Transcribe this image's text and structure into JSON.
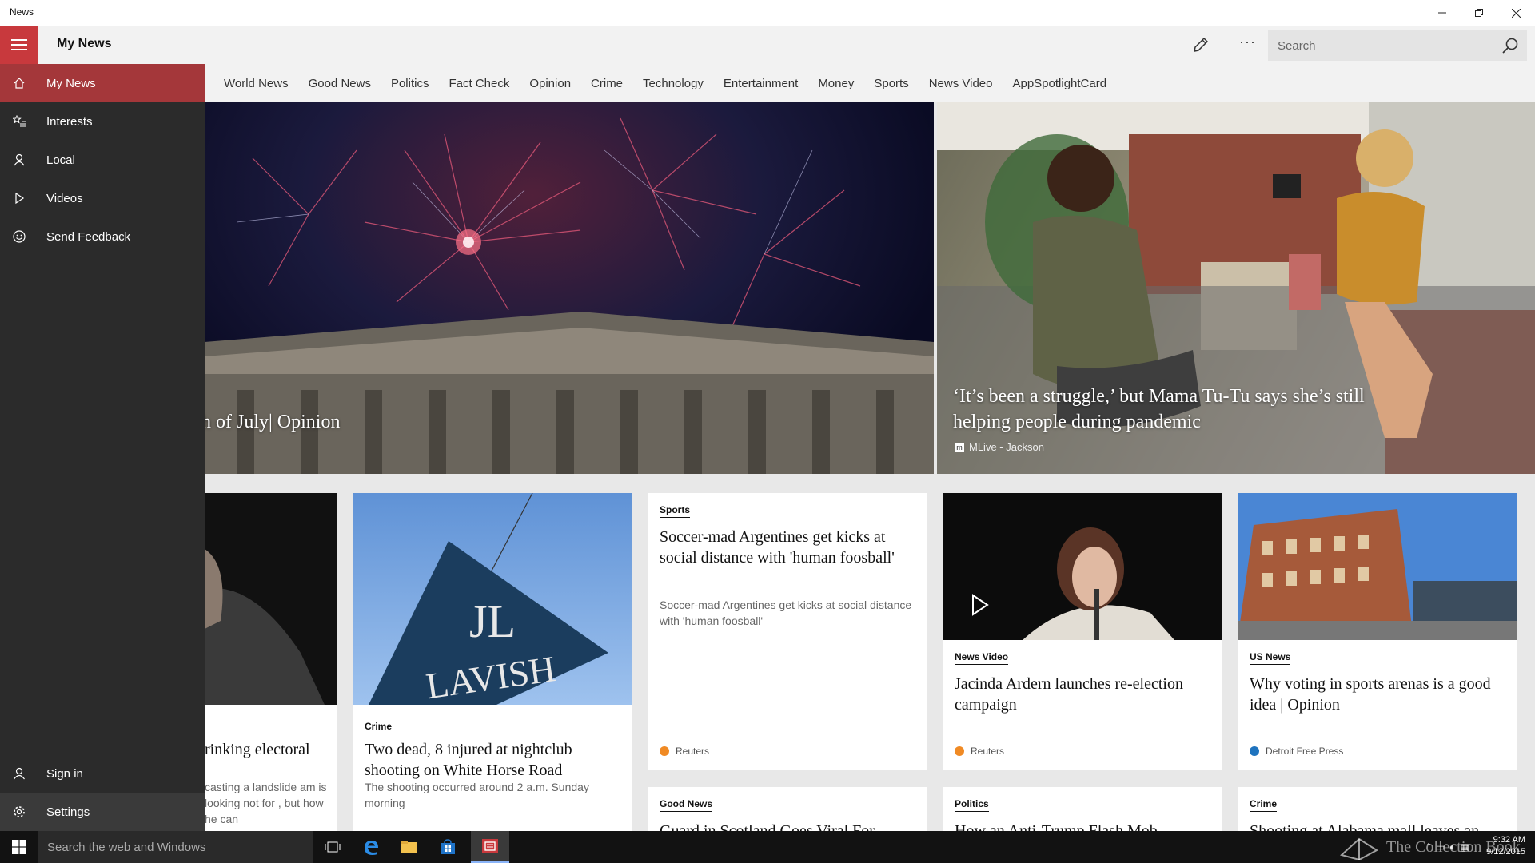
{
  "window": {
    "title": "News"
  },
  "header": {
    "page_title": "My News",
    "search_placeholder": "Search"
  },
  "tabs": [
    "World News",
    "Good News",
    "Politics",
    "Fact Check",
    "Opinion",
    "Crime",
    "Technology",
    "Entertainment",
    "Money",
    "Sports",
    "News Video",
    "AppSpotlightCard"
  ],
  "nav": {
    "items": [
      {
        "label": "My News",
        "icon": "home-icon"
      },
      {
        "label": "Interests",
        "icon": "star-list-icon"
      },
      {
        "label": "Local",
        "icon": "person-pin-icon"
      },
      {
        "label": "Videos",
        "icon": "play-icon"
      },
      {
        "label": "Send Feedback",
        "icon": "smiley-icon"
      }
    ],
    "bottom": [
      {
        "label": "Sign in",
        "icon": "person-icon"
      },
      {
        "label": "Settings",
        "icon": "gear-icon"
      }
    ]
  },
  "hero": [
    {
      "title": "h of July| Opinion"
    },
    {
      "title": "‘It’s been a struggle,’ but Mama Tu-Tu says she’s still helping people during pandemic",
      "source": "MLive - Jackson"
    }
  ],
  "cards": [
    {
      "title": "rinking electoral",
      "desc": "casting a landslide am is looking not for , but how he can"
    },
    {
      "category": "Crime",
      "title": "Two dead, 8 injured at nightclub shooting on White Horse Road",
      "desc": "The shooting occurred around 2 a.m. Sunday morning",
      "image_text": "LAVISH"
    },
    {
      "category": "Sports",
      "title": "Soccer-mad Argentines get kicks at social distance with 'human foosball'",
      "desc": "Soccer-mad Argentines get kicks at social distance with 'human foosball'",
      "source": "Reuters"
    },
    {
      "category": "News Video",
      "title": "Jacinda Ardern launches re-election campaign",
      "source": "Reuters"
    },
    {
      "category": "US News",
      "title": "Why voting in sports arenas is a good idea | Opinion",
      "source": "Detroit Free Press"
    },
    {
      "category": "Good News",
      "title": "Guard in Scotland Goes Viral For"
    },
    {
      "category": "Politics",
      "title": "How an Anti-Trump Flash Mob"
    },
    {
      "category": "Crime",
      "title": "Shooting at Alabama mall leaves an"
    }
  ],
  "taskbar": {
    "search_placeholder": "Search the web and Windows",
    "time": "9:32 AM",
    "date": "9/12/2015",
    "watermark": "The Collection Book"
  },
  "colors": {
    "accent": "#c8393d",
    "nav_active": "#a4373a",
    "nav_bg": "#2b2b2b"
  }
}
